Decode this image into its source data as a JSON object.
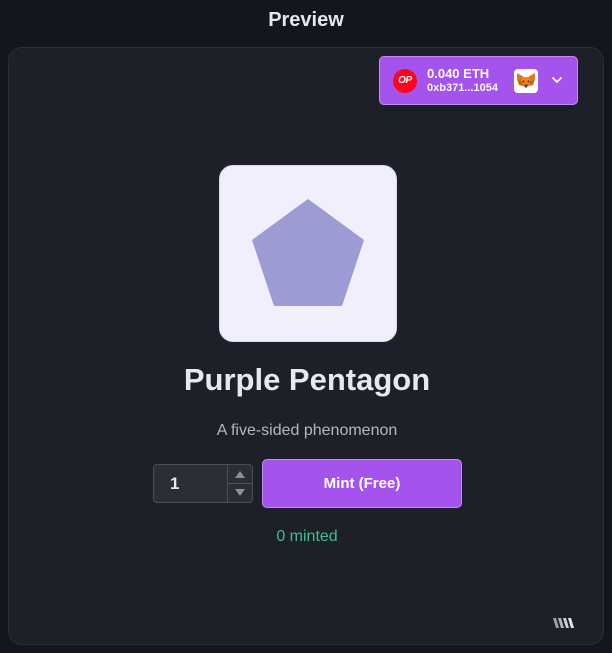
{
  "header": {
    "title": "Preview"
  },
  "wallet": {
    "network_badge": "OP",
    "balance": "0.040 ETH",
    "address": "0xb371...1054",
    "accent_color": "#a453ec",
    "network_color": "#ff0420",
    "icons": [
      "optimism-icon",
      "metamask-fox-icon",
      "chevron-down-icon"
    ]
  },
  "nft": {
    "name": "Purple Pentagon",
    "description": "A five-sided phenomenon",
    "shape_color": "#9d9bd3"
  },
  "mint": {
    "quantity": "1",
    "button_label": "Mint (Free)",
    "minted_count": "0 minted",
    "minted_color": "#3fbf8a"
  },
  "footer": {
    "brand_icon": "w-logo-icon"
  }
}
